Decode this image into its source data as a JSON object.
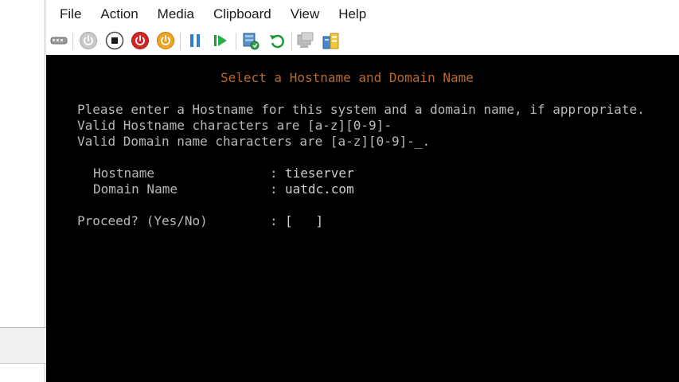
{
  "menu": {
    "file": "File",
    "action": "Action",
    "media": "Media",
    "clipboard": "Clipboard",
    "view": "View",
    "help": "Help"
  },
  "toolbar": {
    "icons": [
      "ctrl-alt-del-icon",
      "start-icon",
      "turn-off-icon",
      "shut-down-icon",
      "save-icon",
      "pause-icon",
      "resume-icon",
      "checkpoint-icon",
      "revert-icon",
      "enhanced-session-icon",
      "share-icon"
    ]
  },
  "console": {
    "title": "Select a Hostname and Domain Name",
    "instructions": [
      "Please enter a Hostname for this system and a domain name, if appropriate.",
      "Valid Hostname characters are [a-z][0-9]-",
      "Valid Domain name characters are [a-z][0-9]-_."
    ],
    "hostname_label": "Hostname",
    "hostname_value": "tieserver",
    "domain_label": "Domain Name",
    "domain_value": "uatdc.com",
    "proceed_label": "Proceed? (Yes/No)",
    "proceed_value": "[   ]",
    "colon": ":"
  },
  "colors": {
    "console_bg": "#000000",
    "console_text": "#b8b8b8",
    "console_title": "#b9692c"
  }
}
